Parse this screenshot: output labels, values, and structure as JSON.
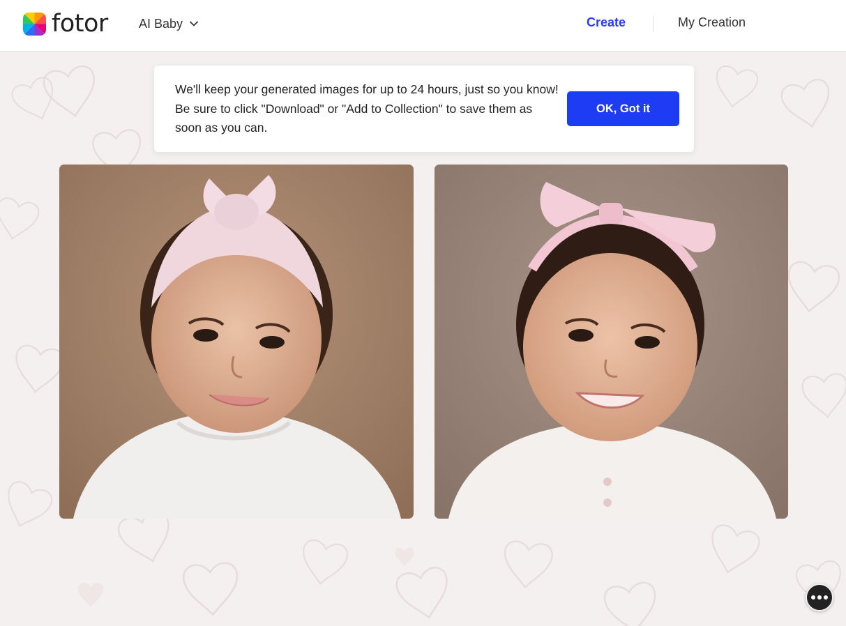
{
  "header": {
    "brand": "fotor",
    "product_menu_label": "AI Baby",
    "nav": {
      "create": "Create",
      "my_creation": "My Creation"
    },
    "accent_color": "#2b3cf0"
  },
  "notice": {
    "message": "We'll keep your generated images for up to 24 hours, just so you know! Be sure to click \"Download\" or \"Add to Collection\" to save them as soon as you can.",
    "button_label": "OK, Got it",
    "button_color": "#1f3cf5"
  },
  "results": [
    {
      "name": "generated-image-1",
      "headband": "pink knotted turban headband"
    },
    {
      "name": "generated-image-2",
      "headband": "pink bow headband"
    }
  ],
  "floating": {
    "more_icon": "more-horizontal-icon"
  }
}
